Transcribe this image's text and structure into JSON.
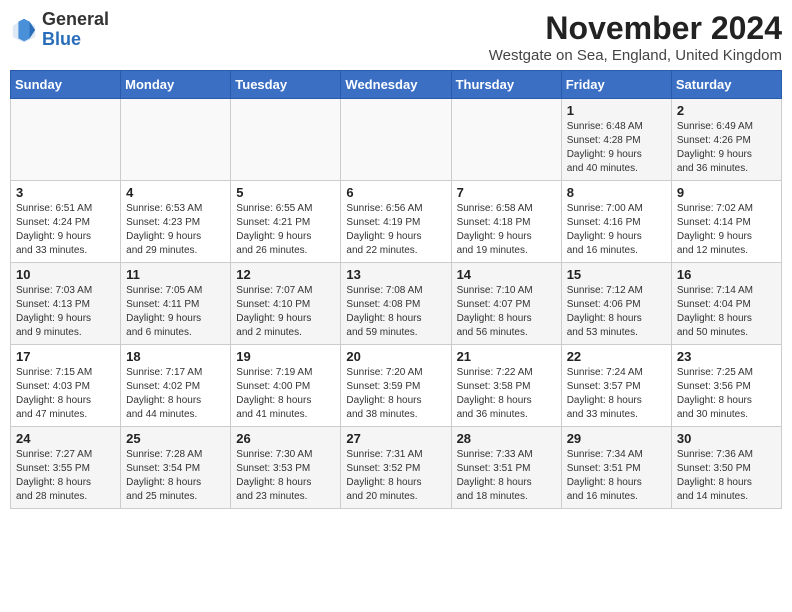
{
  "logo": {
    "general": "General",
    "blue": "Blue"
  },
  "title": "November 2024",
  "subtitle": "Westgate on Sea, England, United Kingdom",
  "days_header": [
    "Sunday",
    "Monday",
    "Tuesday",
    "Wednesday",
    "Thursday",
    "Friday",
    "Saturday"
  ],
  "weeks": [
    [
      {
        "day": "",
        "info": ""
      },
      {
        "day": "",
        "info": ""
      },
      {
        "day": "",
        "info": ""
      },
      {
        "day": "",
        "info": ""
      },
      {
        "day": "",
        "info": ""
      },
      {
        "day": "1",
        "info": "Sunrise: 6:48 AM\nSunset: 4:28 PM\nDaylight: 9 hours\nand 40 minutes."
      },
      {
        "day": "2",
        "info": "Sunrise: 6:49 AM\nSunset: 4:26 PM\nDaylight: 9 hours\nand 36 minutes."
      }
    ],
    [
      {
        "day": "3",
        "info": "Sunrise: 6:51 AM\nSunset: 4:24 PM\nDaylight: 9 hours\nand 33 minutes."
      },
      {
        "day": "4",
        "info": "Sunrise: 6:53 AM\nSunset: 4:23 PM\nDaylight: 9 hours\nand 29 minutes."
      },
      {
        "day": "5",
        "info": "Sunrise: 6:55 AM\nSunset: 4:21 PM\nDaylight: 9 hours\nand 26 minutes."
      },
      {
        "day": "6",
        "info": "Sunrise: 6:56 AM\nSunset: 4:19 PM\nDaylight: 9 hours\nand 22 minutes."
      },
      {
        "day": "7",
        "info": "Sunrise: 6:58 AM\nSunset: 4:18 PM\nDaylight: 9 hours\nand 19 minutes."
      },
      {
        "day": "8",
        "info": "Sunrise: 7:00 AM\nSunset: 4:16 PM\nDaylight: 9 hours\nand 16 minutes."
      },
      {
        "day": "9",
        "info": "Sunrise: 7:02 AM\nSunset: 4:14 PM\nDaylight: 9 hours\nand 12 minutes."
      }
    ],
    [
      {
        "day": "10",
        "info": "Sunrise: 7:03 AM\nSunset: 4:13 PM\nDaylight: 9 hours\nand 9 minutes."
      },
      {
        "day": "11",
        "info": "Sunrise: 7:05 AM\nSunset: 4:11 PM\nDaylight: 9 hours\nand 6 minutes."
      },
      {
        "day": "12",
        "info": "Sunrise: 7:07 AM\nSunset: 4:10 PM\nDaylight: 9 hours\nand 2 minutes."
      },
      {
        "day": "13",
        "info": "Sunrise: 7:08 AM\nSunset: 4:08 PM\nDaylight: 8 hours\nand 59 minutes."
      },
      {
        "day": "14",
        "info": "Sunrise: 7:10 AM\nSunset: 4:07 PM\nDaylight: 8 hours\nand 56 minutes."
      },
      {
        "day": "15",
        "info": "Sunrise: 7:12 AM\nSunset: 4:06 PM\nDaylight: 8 hours\nand 53 minutes."
      },
      {
        "day": "16",
        "info": "Sunrise: 7:14 AM\nSunset: 4:04 PM\nDaylight: 8 hours\nand 50 minutes."
      }
    ],
    [
      {
        "day": "17",
        "info": "Sunrise: 7:15 AM\nSunset: 4:03 PM\nDaylight: 8 hours\nand 47 minutes."
      },
      {
        "day": "18",
        "info": "Sunrise: 7:17 AM\nSunset: 4:02 PM\nDaylight: 8 hours\nand 44 minutes."
      },
      {
        "day": "19",
        "info": "Sunrise: 7:19 AM\nSunset: 4:00 PM\nDaylight: 8 hours\nand 41 minutes."
      },
      {
        "day": "20",
        "info": "Sunrise: 7:20 AM\nSunset: 3:59 PM\nDaylight: 8 hours\nand 38 minutes."
      },
      {
        "day": "21",
        "info": "Sunrise: 7:22 AM\nSunset: 3:58 PM\nDaylight: 8 hours\nand 36 minutes."
      },
      {
        "day": "22",
        "info": "Sunrise: 7:24 AM\nSunset: 3:57 PM\nDaylight: 8 hours\nand 33 minutes."
      },
      {
        "day": "23",
        "info": "Sunrise: 7:25 AM\nSunset: 3:56 PM\nDaylight: 8 hours\nand 30 minutes."
      }
    ],
    [
      {
        "day": "24",
        "info": "Sunrise: 7:27 AM\nSunset: 3:55 PM\nDaylight: 8 hours\nand 28 minutes."
      },
      {
        "day": "25",
        "info": "Sunrise: 7:28 AM\nSunset: 3:54 PM\nDaylight: 8 hours\nand 25 minutes."
      },
      {
        "day": "26",
        "info": "Sunrise: 7:30 AM\nSunset: 3:53 PM\nDaylight: 8 hours\nand 23 minutes."
      },
      {
        "day": "27",
        "info": "Sunrise: 7:31 AM\nSunset: 3:52 PM\nDaylight: 8 hours\nand 20 minutes."
      },
      {
        "day": "28",
        "info": "Sunrise: 7:33 AM\nSunset: 3:51 PM\nDaylight: 8 hours\nand 18 minutes."
      },
      {
        "day": "29",
        "info": "Sunrise: 7:34 AM\nSunset: 3:51 PM\nDaylight: 8 hours\nand 16 minutes."
      },
      {
        "day": "30",
        "info": "Sunrise: 7:36 AM\nSunset: 3:50 PM\nDaylight: 8 hours\nand 14 minutes."
      }
    ]
  ]
}
